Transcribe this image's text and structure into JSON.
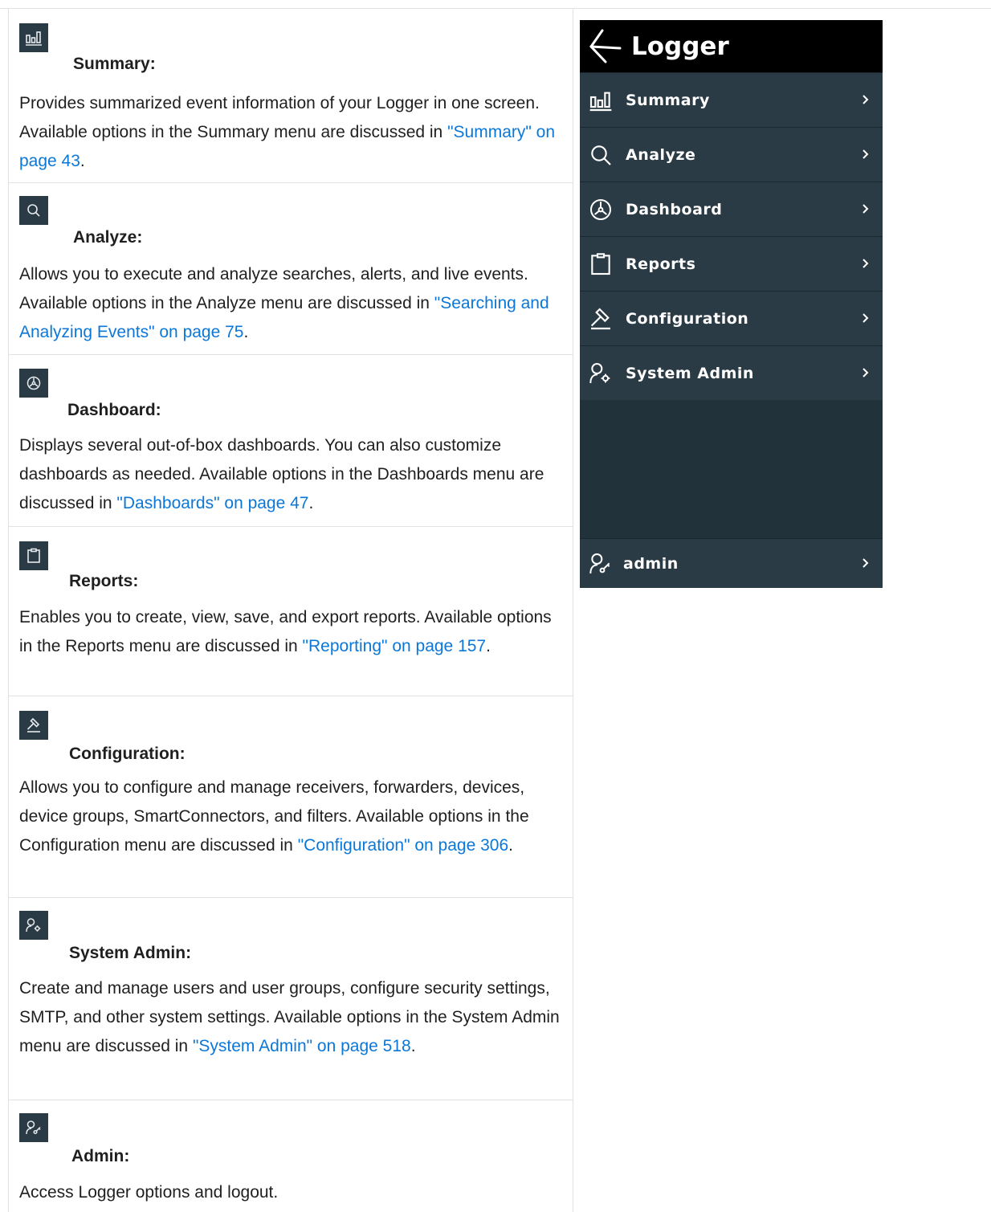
{
  "sections": [
    {
      "icon": "summary-bars-icon",
      "title": "Summary:",
      "desc_before": "Provides summarized event information of your Logger in one screen. Available options in the Summary menu are discussed in ",
      "link": "\"Summary\" on page 43",
      "desc_after": "."
    },
    {
      "icon": "search-icon",
      "title": "Analyze:",
      "desc_before": "Allows you to execute and analyze searches, alerts, and live events. Available options in the Analyze menu are discussed in ",
      "link": "\"Searching and Analyzing Events\" on page 75",
      "desc_after": "."
    },
    {
      "icon": "dashboard-gauge-icon",
      "title": "Dashboard:",
      "desc_before": "Displays several out-of-box dashboards. You can also customize dashboards as needed. Available options in the Dashboards menu are discussed in ",
      "link": "\"Dashboards\" on page 47",
      "desc_after": "."
    },
    {
      "icon": "clipboard-icon",
      "title": "Reports:",
      "desc_before": "Enables you to create, view, save, and export reports. Available options in the Reports menu are discussed in ",
      "link": "\"Reporting\" on page 157",
      "desc_after": "."
    },
    {
      "icon": "hammer-icon",
      "title": "Configuration:",
      "desc_before": "Allows you to configure and manage receivers, forwarders, devices, device groups, SmartConnectors, and filters. Available options in the Configuration menu are discussed in ",
      "link": "\"Configuration\" on page 306",
      "desc_after": "."
    },
    {
      "icon": "user-gear-icon",
      "title": "System Admin:",
      "desc_before": "Create and manage users and user groups, configure security settings, SMTP, and other system settings. Available options in the System Admin menu are discussed in ",
      "link": "\"System Admin\" on page 518",
      "desc_after": "."
    },
    {
      "icon": "user-key-icon",
      "title": "Admin:",
      "desc_before": "Access Logger options and logout.",
      "link": "",
      "desc_after": ""
    }
  ],
  "menu": {
    "title": "Logger",
    "items": [
      {
        "label": "Summary",
        "icon": "summary-bars-icon"
      },
      {
        "label": "Analyze",
        "icon": "search-icon"
      },
      {
        "label": "Dashboard",
        "icon": "dashboard-gauge-icon"
      },
      {
        "label": "Reports",
        "icon": "clipboard-icon"
      },
      {
        "label": "Configuration",
        "icon": "hammer-icon"
      },
      {
        "label": "System Admin",
        "icon": "user-gear-icon"
      }
    ],
    "footer": {
      "label": "admin",
      "icon": "user-key-icon"
    }
  },
  "colors": {
    "link": "#0b77d8",
    "menu_item_bg": "#2b3b45",
    "menu_bg": "#22323b",
    "menu_header_bg": "#000000"
  }
}
